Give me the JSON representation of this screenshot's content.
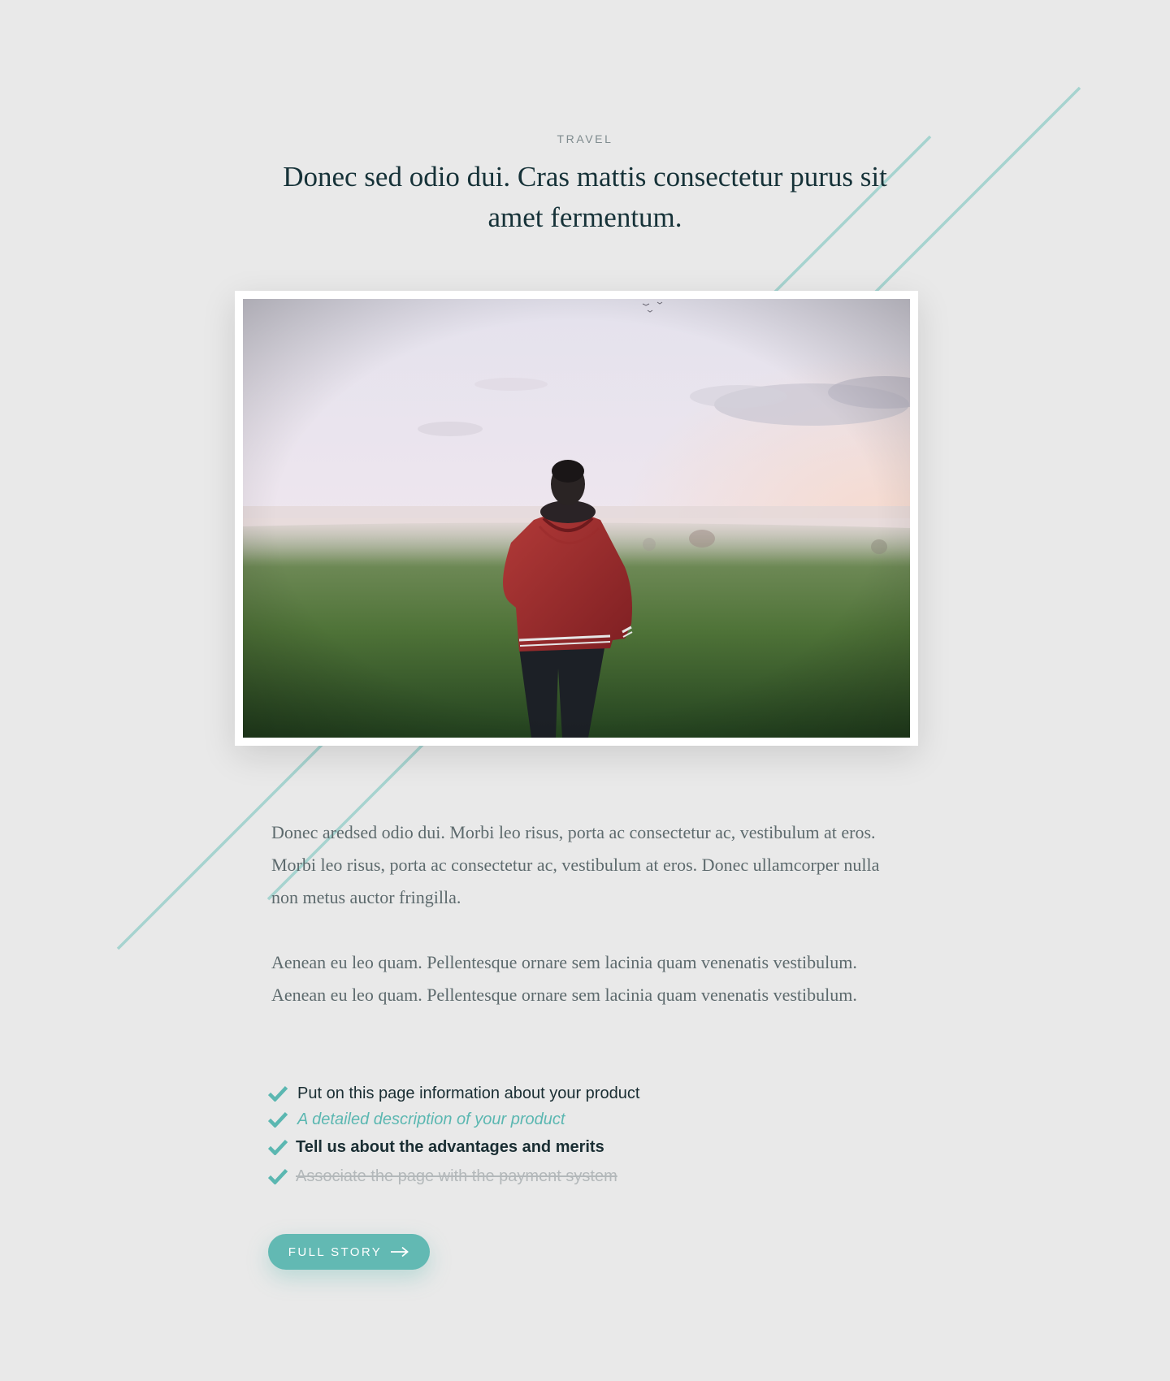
{
  "article": {
    "category": "TRAVEL",
    "title": "Donec sed odio dui. Cras mattis consectetur purus sit amet fermentum.",
    "image_icon": "photo-man-in-red-jacket-in-foggy-field",
    "paragraphs": [
      "Donec aredsed odio dui. Morbi leo risus, porta ac consectetur ac, vestibulum at eros. Morbi leo risus, porta ac consectetur ac, vestibulum at eros. Donec ullamcorper nulla non metus auctor fringilla.",
      "Aenean eu leo quam. Pellentesque ornare sem lacinia quam venenatis vestibulum. Aenean eu leo quam. Pellentesque ornare sem lacinia quam venenatis vestibulum."
    ],
    "checklist": [
      {
        "text": "Put on this page information about your product",
        "style": "normal",
        "icon": "check-icon"
      },
      {
        "text": "A detailed description of your product",
        "style": "italic",
        "icon": "check-icon"
      },
      {
        "text": "Tell us about the advantages and merits",
        "style": "bold",
        "icon": "check-icon"
      },
      {
        "text": "Associate the page with the payment system",
        "style": "strikethrough",
        "icon": "check-icon"
      }
    ],
    "cta": {
      "label": "FULL STORY",
      "icon": "arrow-right-icon"
    }
  },
  "colors": {
    "background": "#e9e9e9",
    "accent": "#62b9b3",
    "deco_line": "#a6d3cf",
    "heading": "#163238",
    "body_text": "#5d6a6d",
    "muted": "#b3b8ba"
  }
}
